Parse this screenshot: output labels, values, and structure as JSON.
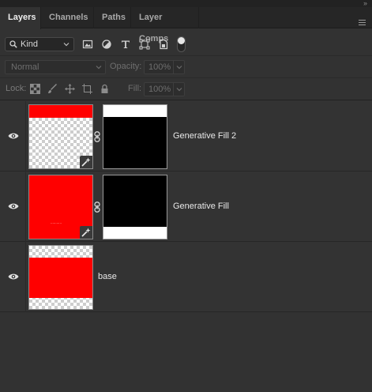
{
  "tabs": [
    {
      "label": "Layers",
      "active": true
    },
    {
      "label": "Channels",
      "active": false
    },
    {
      "label": "Paths",
      "active": false
    },
    {
      "label": "Layer Comps",
      "active": false
    }
  ],
  "filter": {
    "kind_label": "Kind",
    "icons": [
      "pixel-filter-icon",
      "adjustment-filter-icon",
      "type-filter-icon",
      "shape-filter-icon",
      "smart-object-filter-icon"
    ]
  },
  "blend": {
    "mode": "Normal",
    "opacity_label": "Opacity:",
    "opacity_value": "100%",
    "fill_label": "Fill:",
    "fill_value": "100%"
  },
  "lock": {
    "label": "Lock:",
    "icons": [
      "lock-transparent-pixels-icon",
      "lock-image-pixels-icon",
      "lock-position-icon",
      "lock-artboard-icon",
      "lock-all-icon"
    ]
  },
  "layers": [
    {
      "name": "Generative Fill 2",
      "visible": true,
      "has_mask": true,
      "generative": true
    },
    {
      "name": "Generative Fill",
      "visible": true,
      "has_mask": true,
      "generative": true,
      "thumb_text": "..........."
    },
    {
      "name": "base",
      "visible": true,
      "has_mask": false,
      "generative": false
    }
  ],
  "colors": {
    "panel_bg": "#323232",
    "tab_bar_bg": "#262626",
    "layer_fill": "#ff0000",
    "mask_black": "#000000",
    "mask_white": "#ffffff"
  }
}
